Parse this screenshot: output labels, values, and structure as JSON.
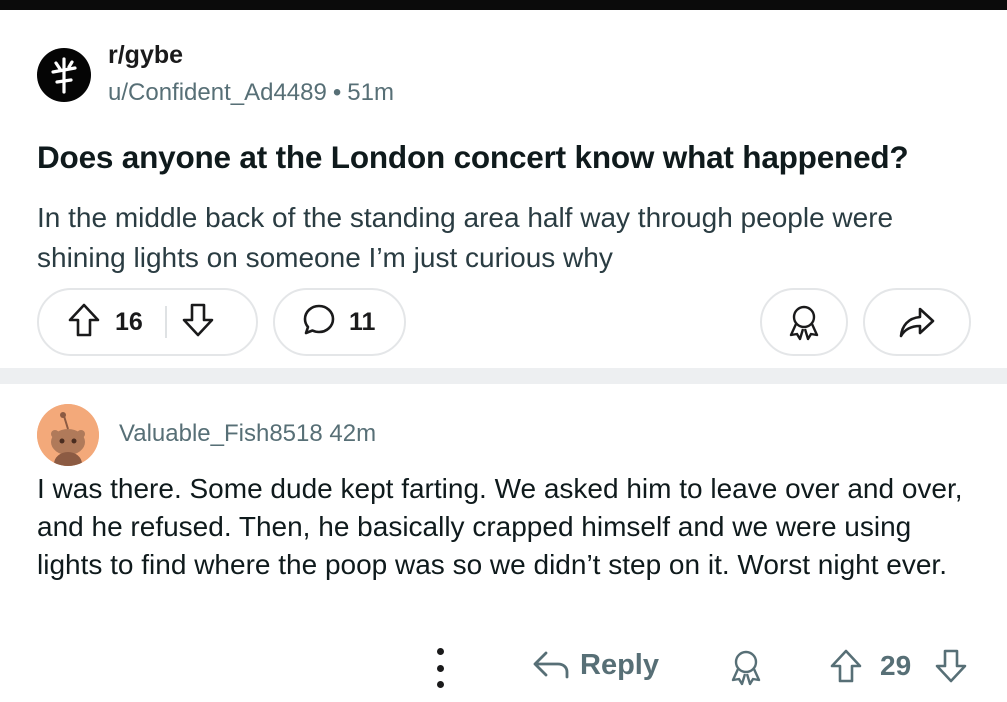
{
  "post": {
    "subreddit": "r/gybe",
    "author": "u/Confident_Ad4489",
    "separator": "•",
    "age": "51m",
    "title": "Does anyone at the London concert know what happened?",
    "body": "In the middle back of the standing area half way through people were shining lights on someone I’m just curious why",
    "score": "16",
    "comment_count": "11",
    "icons": {
      "subreddit_avatar": "subreddit-logo-glyph",
      "upvote": "arrow-up-outline-icon",
      "downvote": "arrow-down-outline-icon",
      "comments": "speech-bubble-icon",
      "award": "award-ribbon-icon",
      "share": "share-arrow-icon"
    }
  },
  "comment": {
    "author": "Valuable_Fish8518",
    "age": "42m",
    "body": "I was there. Some dude kept farting. We asked him to leave over and over, and he refused. Then, he basically crapped himself and we were using lights to find where the poop was so we didn’t step on it. Worst night ever.",
    "reply_label": "Reply",
    "score": "29",
    "icons": {
      "avatar": "snoo-avatar-icon",
      "more": "more-options-icon",
      "reply": "reply-arrow-icon",
      "award": "award-ribbon-icon",
      "upvote": "arrow-up-outline-icon",
      "downvote": "arrow-down-outline-icon"
    }
  },
  "colors": {
    "text": "#1a1a1b",
    "meta": "#576f76",
    "border": "#e4e6e8",
    "divider": "#edeff1",
    "comment_avatar_bg": "#f3a97a",
    "top_bar": "#0b0b0b"
  }
}
